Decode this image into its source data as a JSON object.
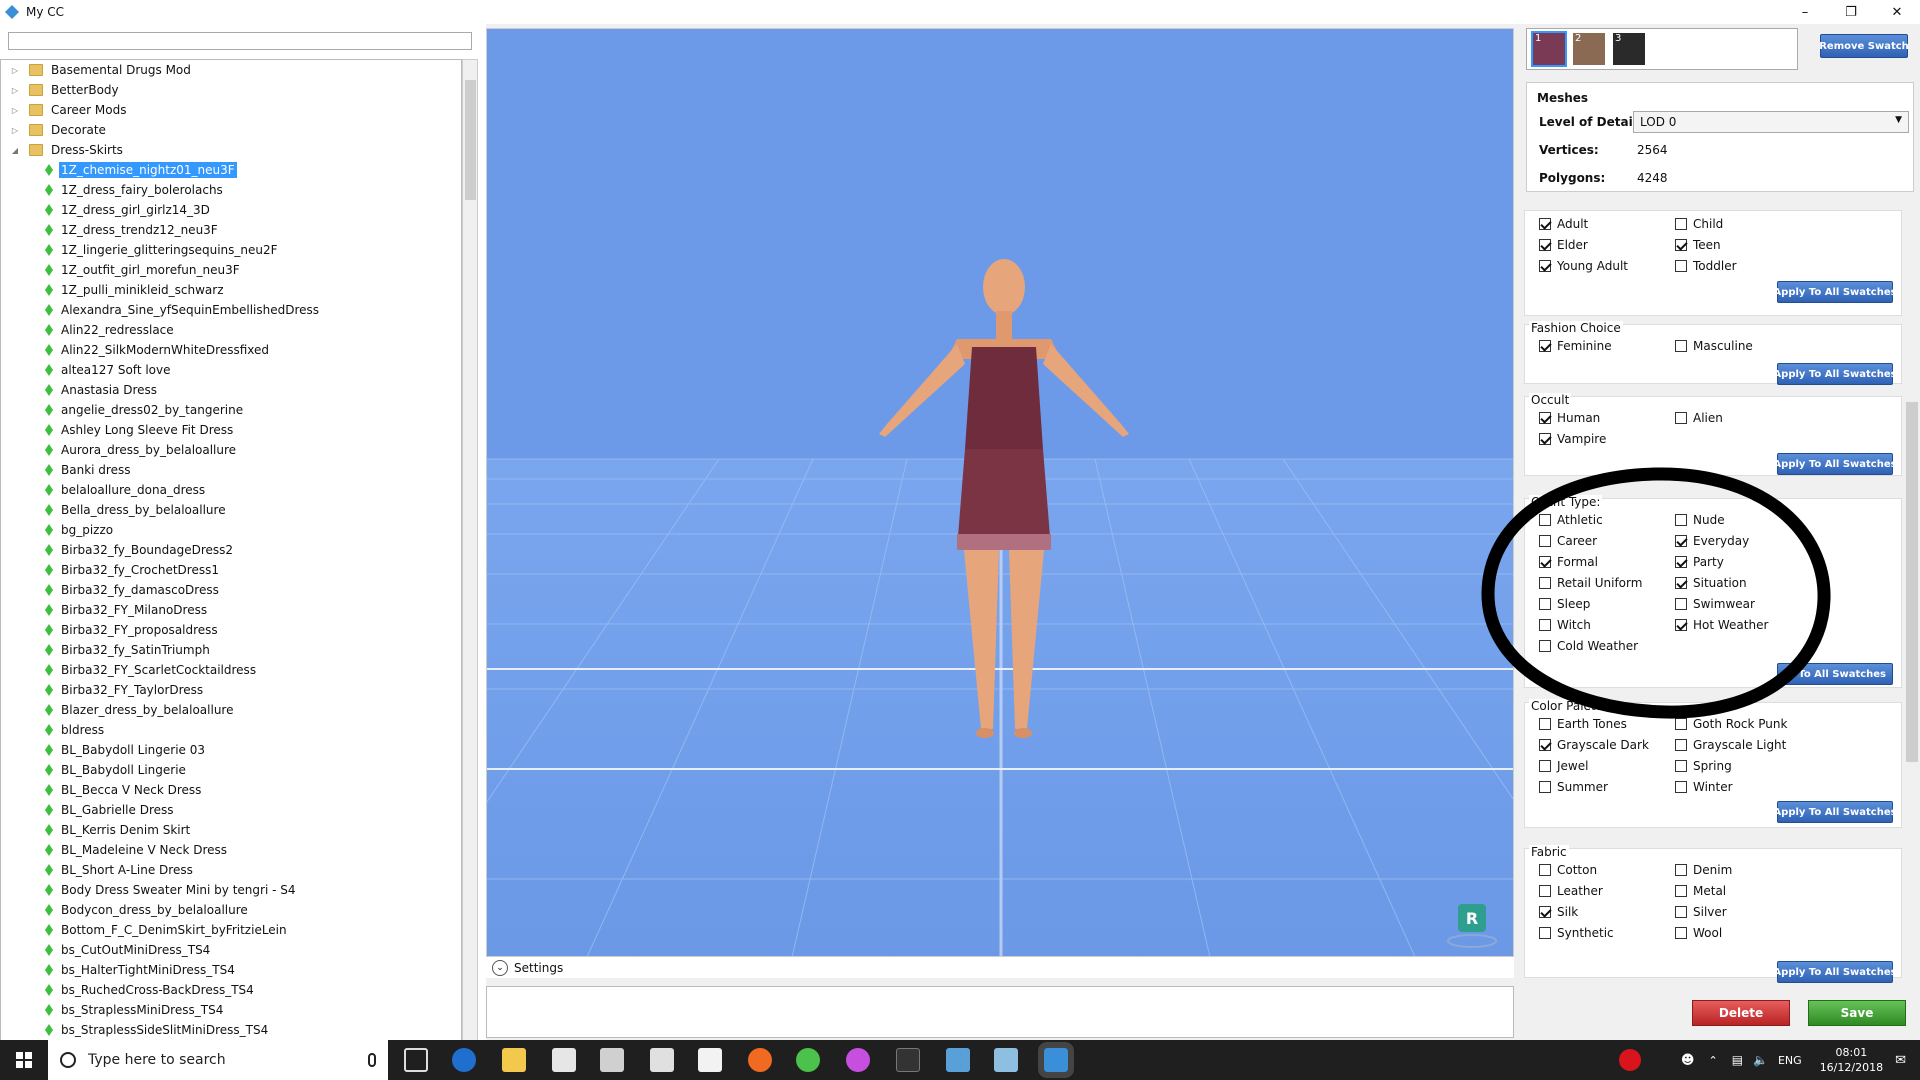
{
  "window": {
    "title": "My CC"
  },
  "tree": {
    "folders": [
      "Basemental Drugs Mod",
      "BetterBody",
      "Career Mods",
      "Decorate",
      "Dress-Skirts"
    ],
    "files": [
      "1Z_chemise_nightz01_neu3F",
      "1Z_dress_fairy_bolerolachs",
      "1Z_dress_girl_girlz14_3D",
      "1Z_dress_trendz12_neu3F",
      "1Z_lingerie_glitteringsequins_neu2F",
      "1Z_outfit_girl_morefun_neu3F",
      "1Z_pulli_minikleid_schwarz",
      "Alexandra_Sine_yfSequinEmbellishedDress",
      "Alin22_redresslace",
      "Alin22_SilkModernWhiteDressfixed",
      "altea127 Soft love",
      "Anastasia Dress",
      "angelie_dress02_by_tangerine",
      "Ashley Long Sleeve Fit Dress",
      "Aurora_dress_by_belaloallure",
      "Banki dress",
      "belaloallure_dona_dress",
      "Bella_dress_by_belaloallure",
      "bg_pizzo",
      "Birba32_fy_BoundageDress2",
      "Birba32_fy_CrochetDress1",
      "Birba32_fy_damascoDress",
      "Birba32_FY_MilanoDress",
      "Birba32_FY_proposaldress",
      "Birba32_fy_SatinTriumph",
      "Birba32_FY_ScarletCocktaildress",
      "Birba32_FY_TaylorDress",
      "Blazer_dress_by_belaloallure",
      "bldress",
      "BL_Babydoll Lingerie 03",
      "BL_Babydoll Lingerie",
      "BL_Becca V Neck Dress",
      "BL_Gabrielle Dress",
      "BL_Kerris Denim Skirt",
      "BL_Madeleine V Neck Dress",
      "BL_Short A-Line Dress",
      "Body Dress Sweater Mini by tengri - S4",
      "Bodycon_dress_by_belaloallure",
      "Bottom_F_C_DenimSkirt_byFritzieLein",
      "bs_CutOutMiniDress_TS4",
      "bs_HalterTightMiniDress_TS4",
      "bs_RuchedCross-BackDress_TS4",
      "bs_StraplessMiniDress_TS4",
      "bs_StraplessSideSlitMiniDress_TS4"
    ]
  },
  "viewport": {
    "settings_label": "Settings",
    "badge": "R"
  },
  "swatches": {
    "items": [
      {
        "label": "1",
        "color": "#7a3a55"
      },
      {
        "label": "2",
        "color": "#8a6a52"
      },
      {
        "label": "3",
        "color": "#2a2a2a"
      }
    ],
    "remove_label": "Remove Swatch"
  },
  "meshes": {
    "title": "Meshes",
    "lod_label": "Level of Detail",
    "lod_value": "LOD 0",
    "vertices_label": "Vertices:",
    "vertices": "2564",
    "polygons_label": "Polygons:",
    "polygons": "4248"
  },
  "apply_label": "Apply To All Swatches",
  "apply_label_partial": "y To All Swatches",
  "age": {
    "items": [
      {
        "label": "Adult",
        "checked": true
      },
      {
        "label": "Child",
        "checked": false
      },
      {
        "label": "Elder",
        "checked": true
      },
      {
        "label": "Teen",
        "checked": true
      },
      {
        "label": "Young Adult",
        "checked": true
      },
      {
        "label": "Toddler",
        "checked": false
      }
    ]
  },
  "fashion": {
    "title": "Fashion Choice",
    "items": [
      {
        "label": "Feminine",
        "checked": true
      },
      {
        "label": "Masculine",
        "checked": false
      }
    ]
  },
  "occult": {
    "title": "Occult",
    "items": [
      {
        "label": "Human",
        "checked": true
      },
      {
        "label": "Alien",
        "checked": false
      },
      {
        "label": "Vampire",
        "checked": true
      }
    ]
  },
  "outfit": {
    "title": "Outfit Type:",
    "items": [
      {
        "label": "Athletic",
        "checked": false
      },
      {
        "label": "Nude",
        "checked": false
      },
      {
        "label": "Career",
        "checked": false
      },
      {
        "label": "Everyday",
        "checked": true
      },
      {
        "label": "Formal",
        "checked": true
      },
      {
        "label": "Party",
        "checked": true
      },
      {
        "label": "Retail Uniform",
        "checked": false
      },
      {
        "label": "Situation",
        "checked": true
      },
      {
        "label": "Sleep",
        "checked": false
      },
      {
        "label": "Swimwear",
        "checked": false
      },
      {
        "label": "Witch",
        "checked": false
      },
      {
        "label": "Hot Weather",
        "checked": true
      },
      {
        "label": "Cold Weather",
        "checked": false
      }
    ]
  },
  "palette": {
    "title": "Color Palette",
    "items": [
      {
        "label": "Earth Tones",
        "checked": false
      },
      {
        "label": "Goth Rock Punk",
        "checked": false
      },
      {
        "label": "Grayscale Dark",
        "checked": true
      },
      {
        "label": "Grayscale Light",
        "checked": false
      },
      {
        "label": "Jewel",
        "checked": false
      },
      {
        "label": "Spring",
        "checked": false
      },
      {
        "label": "Summer",
        "checked": false
      },
      {
        "label": "Winter",
        "checked": false
      }
    ]
  },
  "fabric": {
    "title": "Fabric",
    "items": [
      {
        "label": "Cotton",
        "checked": false
      },
      {
        "label": "Denim",
        "checked": false
      },
      {
        "label": "Leather",
        "checked": false
      },
      {
        "label": "Metal",
        "checked": false
      },
      {
        "label": "Silk",
        "checked": true
      },
      {
        "label": "Silver",
        "checked": false
      },
      {
        "label": "Synthetic",
        "checked": false
      },
      {
        "label": "Wool",
        "checked": false
      }
    ]
  },
  "actions": {
    "delete_label": "Delete",
    "save_label": "Save"
  },
  "taskbar": {
    "search_placeholder": "Type here to search",
    "language": "ENG",
    "time": "08:01",
    "date": "16/12/2018"
  }
}
